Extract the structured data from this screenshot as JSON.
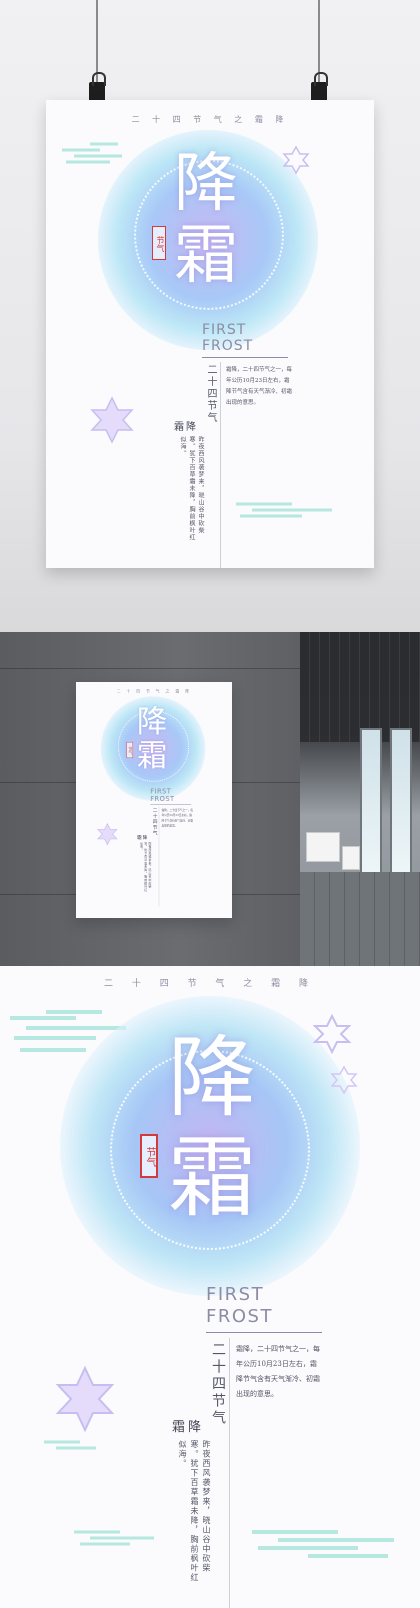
{
  "poster": {
    "top_line": "二 十 四 节 气 之 霜 降",
    "title_char_1": "降",
    "title_char_2": "霜",
    "seal_text": "节气",
    "en_line_1": "FIRST",
    "en_line_2": "FROST",
    "solar_term_label": "二十四节气",
    "description": "霜降，二十四节气之一，每年公历10月23日左右，霜降节气含有天气渐冷、初霜出现的意思。",
    "name": "霜降",
    "poem": "昨夜西风袭梦来，晓山谷中砍柴寒。犹下百草霜未降，胸前枫叶红似海。"
  },
  "colors": {
    "accent_purple": "#c4b5f3",
    "accent_blue": "#a6c6f6",
    "accent_cyan": "#bfe6f6",
    "seal_red": "#d23b3b",
    "text_gray": "#8c8ca4"
  },
  "icons": [
    "snowflake-icon",
    "cloud-pattern-icon",
    "binder-clip-icon"
  ]
}
